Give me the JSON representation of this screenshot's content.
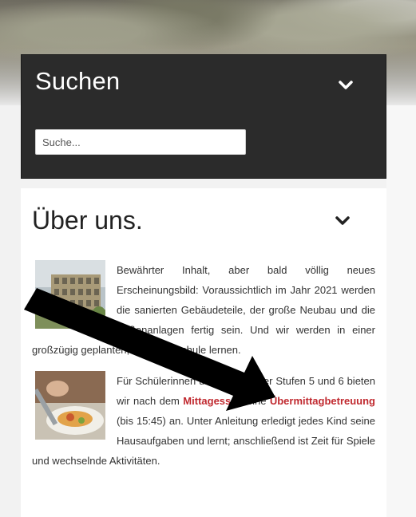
{
  "search": {
    "title": "Suchen",
    "placeholder": "Suche..."
  },
  "about": {
    "title": "Über uns.",
    "para1": {
      "text": "Bewährter Inhalt, aber bald völlig neues Erscheinungsbild: Voraussichtlich im Jahr 2021 werden die sanierten Gebäudeteile, der große Neubau und die Außenanlagen fertig sein. Und wir werden in einer großzügig geplanten, schönen Schule lernen."
    },
    "para2": {
      "text_a": "Für Schülerinnen und Schüler der Stufen 5 und 6 bieten wir nach dem ",
      "link1": "Mittagessen",
      "text_b": " eine ",
      "link2": "Übermittagbetreuung",
      "text_c": " (bis 15:45) an. Unter Anleitung erledigt jedes Kind seine Hausaufgaben und lernt; anschließend ist Zeit für Spiele und wechselnde Aktivitäten."
    }
  },
  "colors": {
    "search_bg": "#2b2b2b",
    "link": "#c0292f"
  },
  "icons": [
    "chevron-down-icon",
    "building-photo",
    "lunch-photo",
    "arrow-annotation"
  ]
}
